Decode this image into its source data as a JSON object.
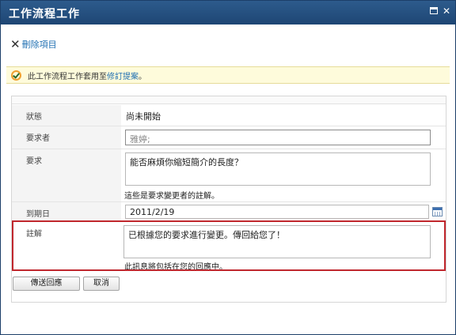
{
  "window": {
    "title": "工作流程工作"
  },
  "toolbar": {
    "delete_label": "刪除項目"
  },
  "status": {
    "prefix": "此工作流程工作套用至",
    "link": "修訂提案",
    "suffix": "。"
  },
  "form": {
    "status": {
      "label": "狀態",
      "value": "尚未開始"
    },
    "requester": {
      "label": "要求者",
      "value": "雅婷;"
    },
    "request": {
      "label": "要求",
      "value": "能否麻煩你縮短簡介的長度？",
      "hint": "這些是要求變更者的註解。"
    },
    "due_date": {
      "label": "到期日",
      "value": "2011/2/19"
    },
    "comments": {
      "label": "註解",
      "value": "已根據您的要求進行變更。傳回給您了！",
      "hint": "此訊息將包括在您的回應中。"
    }
  },
  "buttons": {
    "send": "傳送回應",
    "cancel": "取消"
  },
  "colors": {
    "titlebar": "#1e4674",
    "link": "#1f6fb2",
    "highlight_border": "#c0272d",
    "status_bg": "#fefbdb"
  }
}
